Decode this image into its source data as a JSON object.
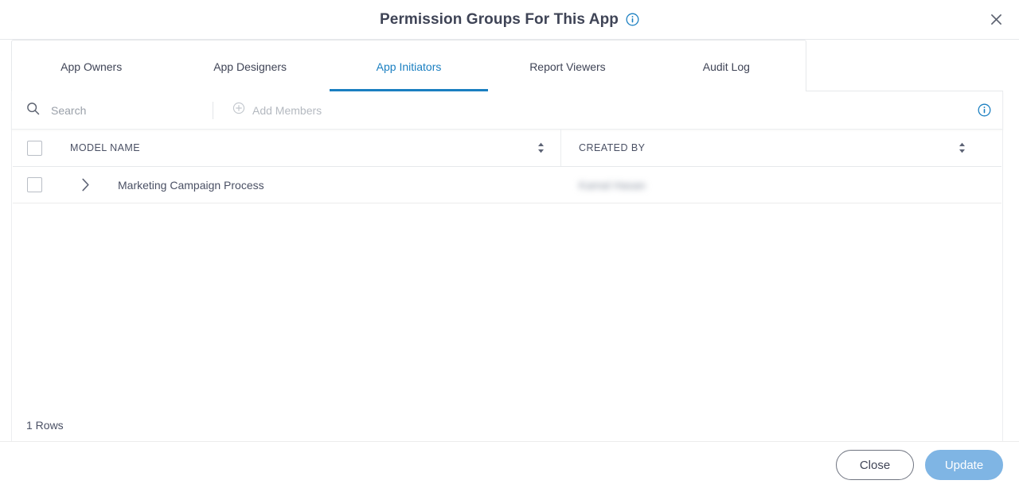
{
  "header": {
    "title": "Permission Groups For This App",
    "info_icon": "info-circle-icon",
    "close_icon": "close-icon"
  },
  "tabs": [
    {
      "label": "App Owners",
      "active": false
    },
    {
      "label": "App Designers",
      "active": false
    },
    {
      "label": "App Initiators",
      "active": true
    },
    {
      "label": "Report Viewers",
      "active": false
    },
    {
      "label": "Audit Log",
      "active": false
    }
  ],
  "toolbar": {
    "search_placeholder": "Search",
    "search_value": "",
    "search_icon": "search-icon",
    "add_members_label": "Add Members",
    "add_members_icon": "plus-circle-icon",
    "info_icon": "info-circle-icon"
  },
  "table": {
    "columns": [
      {
        "label": "MODEL NAME",
        "sort_icon": "sort-arrows-icon"
      },
      {
        "label": "CREATED BY",
        "sort_icon": "sort-arrows-icon"
      }
    ],
    "select_all_checked": false,
    "rows": [
      {
        "checked": false,
        "expand_icon": "chevron-right-icon",
        "model_name": "Marketing Campaign Process",
        "created_by": "Kamal Hasan",
        "created_by_redacted": true
      }
    ],
    "row_count_label": "1 Rows"
  },
  "footer": {
    "close_label": "Close",
    "update_label": "Update"
  },
  "colors": {
    "accent": "#1a7fc1",
    "primary_button": "#7fb5e4",
    "text": "#3f4456",
    "muted_text": "#b4b9c0",
    "border": "#e6e8eb"
  }
}
